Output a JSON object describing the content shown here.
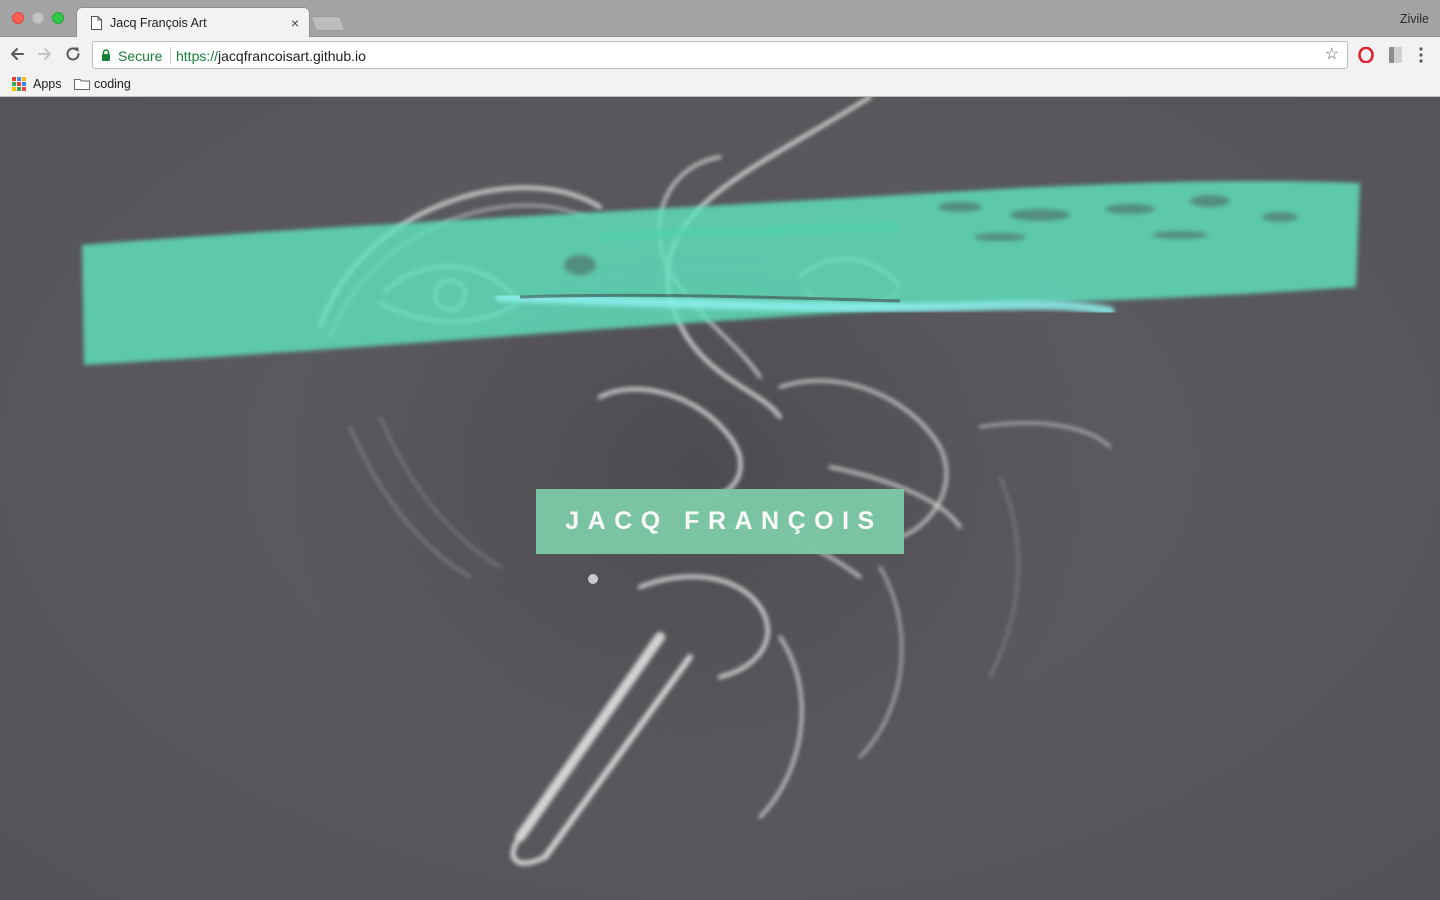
{
  "browser": {
    "tab_title": "Jacq François Art",
    "tab_close": "×",
    "profile_name": "Zivile",
    "security_label": "Secure",
    "url_scheme": "https://",
    "url_host": "jacqfrancoisart.github.io",
    "bookmarks": [
      {
        "label": "Apps",
        "icon": "apps-grid-icon"
      },
      {
        "label": "coding",
        "icon": "folder-icon"
      }
    ],
    "icons": [
      "back-arrow-icon",
      "forward-arrow-icon",
      "reload-icon",
      "lock-icon",
      "star-icon",
      "opera-icon",
      "extension-icon",
      "menu-dots-icon"
    ]
  },
  "page": {
    "site_title": "JACQ FRANÇOIS",
    "background_image": "sketch-face-artwork"
  },
  "colors": {
    "page_background": "#58575b",
    "title_box": "#7dc8a6",
    "brush_stroke": "#5fe0bd",
    "secure_green": "#188038"
  }
}
